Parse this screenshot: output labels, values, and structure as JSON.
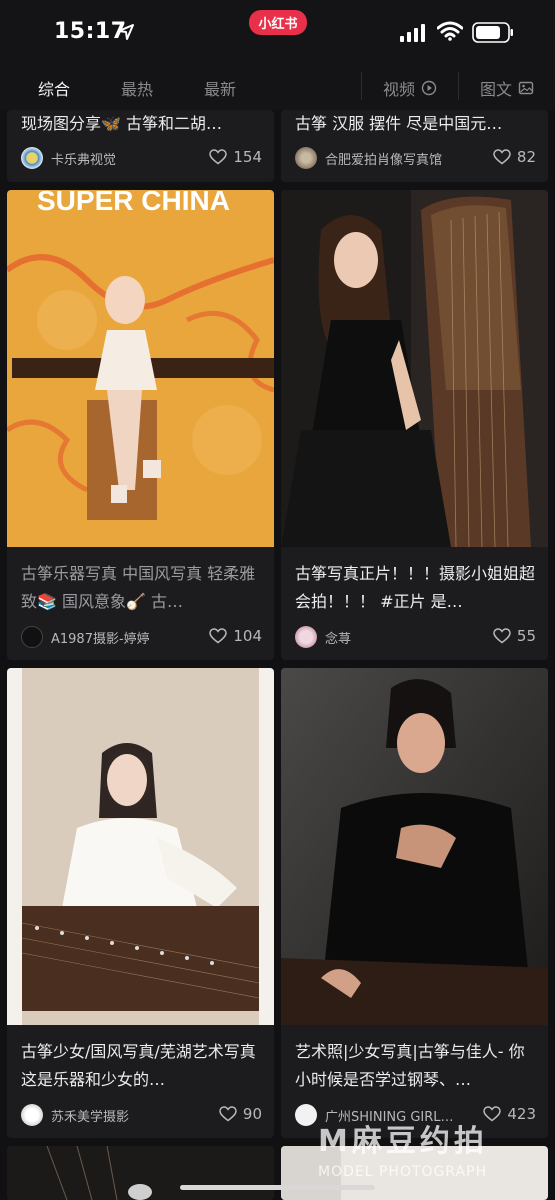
{
  "status_bar": {
    "time": "15:17",
    "app_badge": "小红书"
  },
  "tabs": [
    {
      "label": "综合",
      "active": true
    },
    {
      "label": "最热",
      "active": false
    },
    {
      "label": "最新",
      "active": false
    }
  ],
  "filters": [
    {
      "label": "视频",
      "icon": "play-circle-icon"
    },
    {
      "label": "图文",
      "icon": "image-icon"
    }
  ],
  "cards": [
    {
      "title": "现场图分享🦋 古筝和二胡…",
      "author": "卡乐弗视觉",
      "likes": "154"
    },
    {
      "title": "古筝 汉服 摆件 尽是中国元…",
      "author": "合肥爱拍肖像写真馆",
      "likes": "82"
    },
    {
      "image_text": "SUPER CHINA",
      "title": "古筝乐器写真 中国风写真 轻柔雅致📚 国风意象🪕 古…",
      "author": "A1987摄影-婷婷",
      "likes": "104"
    },
    {
      "title": "古筝写真正片！！！摄影小姐姐超会拍！！！ #正片 是…",
      "author": "念荨",
      "likes": "55"
    },
    {
      "title": "古筝少女/国风写真/芜湖艺术写真 这是乐器和少女的…",
      "author": "苏禾美学摄影",
      "likes": "90"
    },
    {
      "title": "艺术照|少女写真|古筝与佳人- 你小时候是否学过钢琴、…",
      "author": "广州SHINING GIRL…",
      "likes": "423"
    }
  ],
  "watermark": {
    "main": "M麻豆约拍",
    "sub": "MODEL PHOTOGRAPH"
  },
  "colors": {
    "background": "#111113",
    "card": "#1c1c1f",
    "badge": "#e8304a"
  }
}
